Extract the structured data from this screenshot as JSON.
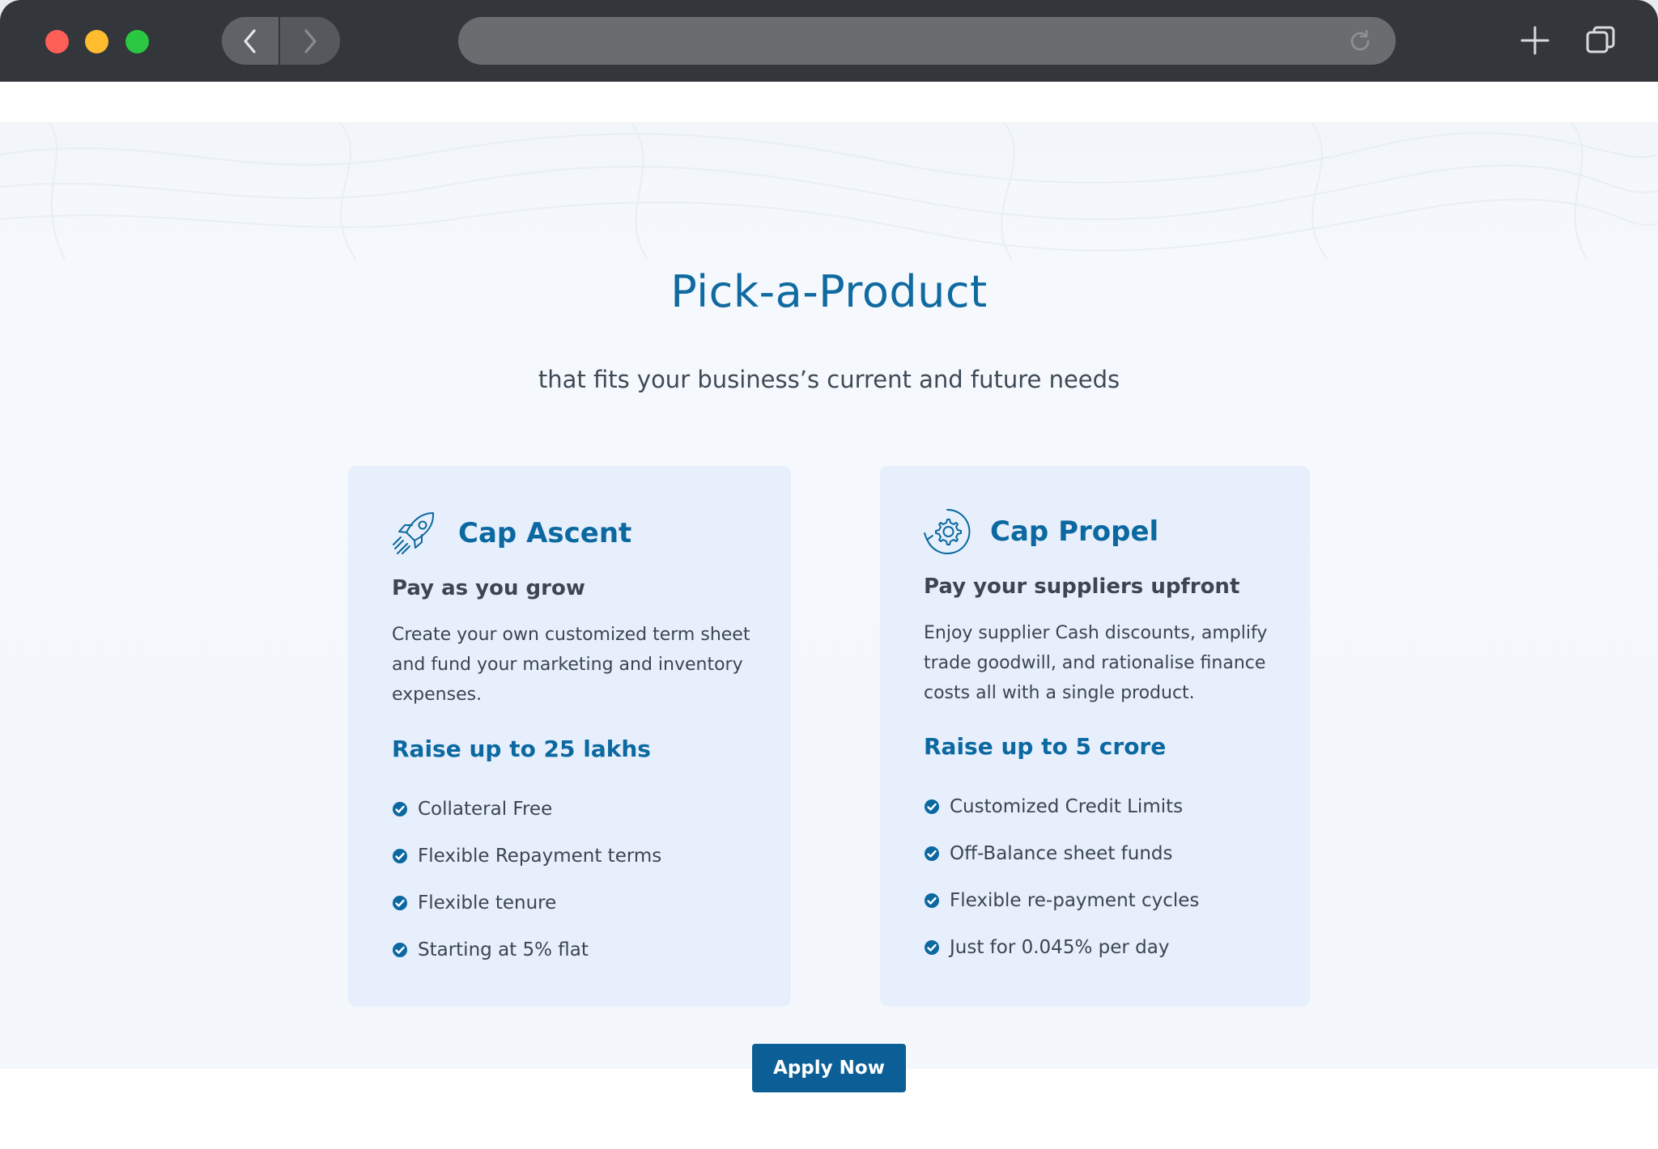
{
  "browser": {
    "url": "",
    "icons": [
      "back-arrow-icon",
      "forward-arrow-icon",
      "reload-icon",
      "plus-icon",
      "tabs-icon"
    ]
  },
  "hero": {
    "title": "Pick-a-Product",
    "subtitle": "that fits your business’s current and future needs"
  },
  "products": [
    {
      "name": "Cap Ascent",
      "icon": "rocket-icon",
      "tagline": "Pay as you grow",
      "description": "Create your own customized term sheet and fund your marketing and inventory expenses.",
      "raise": "Raise up to 25 lakhs",
      "features": [
        "Collateral Free",
        "Flexible Repayment terms",
        "Flexible tenure",
        "Starting at 5% flat"
      ]
    },
    {
      "name": "Cap Propel",
      "icon": "gear-cycle-icon",
      "tagline": "Pay your suppliers upfront",
      "description": "Enjoy supplier Cash discounts, amplify trade goodwill, and rationalise finance costs all with a single product.",
      "raise": "Raise up to 5 crore",
      "features": [
        "Customized Credit Limits",
        "Off-Balance sheet funds",
        "Flexible re-payment cycles",
        "Just for 0.045% per day"
      ]
    }
  ],
  "cta": {
    "label": "Apply Now"
  },
  "colors": {
    "accent": "#0b68a0",
    "button": "#0c5f96",
    "card_bg": "#e7effc",
    "chrome_bg": "#33363b"
  }
}
